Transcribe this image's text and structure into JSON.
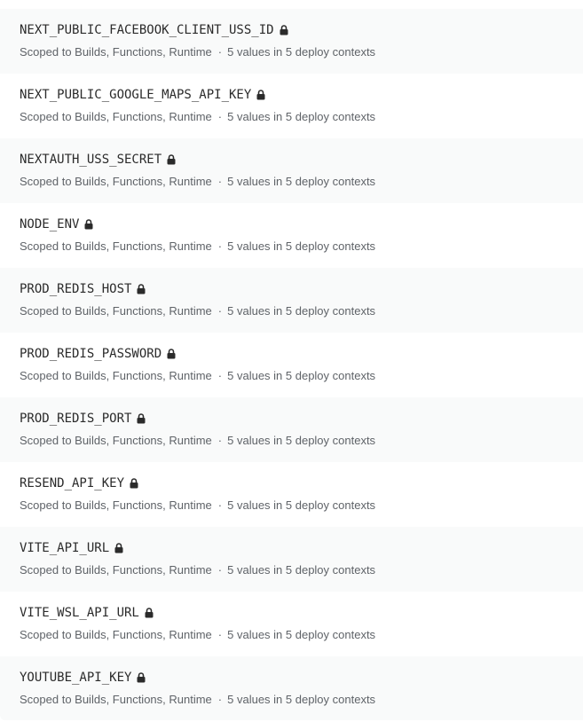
{
  "env_vars": [
    {
      "key": "NEXT_PUBLIC_FACEBOOK_CLIENT_USS_ID",
      "locked_icon": "lock-icon",
      "scope": "Scoped to Builds, Functions, Runtime",
      "separator": "·",
      "values": "5 values in 5 deploy contexts"
    },
    {
      "key": "NEXT_PUBLIC_GOOGLE_MAPS_API_KEY",
      "locked_icon": "lock-icon",
      "scope": "Scoped to Builds, Functions, Runtime",
      "separator": "·",
      "values": "5 values in 5 deploy contexts"
    },
    {
      "key": "NEXTAUTH_USS_SECRET",
      "locked_icon": "lock-icon",
      "scope": "Scoped to Builds, Functions, Runtime",
      "separator": "·",
      "values": "5 values in 5 deploy contexts"
    },
    {
      "key": "NODE_ENV",
      "locked_icon": "lock-icon",
      "scope": "Scoped to Builds, Functions, Runtime",
      "separator": "·",
      "values": "5 values in 5 deploy contexts"
    },
    {
      "key": "PROD_REDIS_HOST",
      "locked_icon": "lock-icon",
      "scope": "Scoped to Builds, Functions, Runtime",
      "separator": "·",
      "values": "5 values in 5 deploy contexts"
    },
    {
      "key": "PROD_REDIS_PASSWORD",
      "locked_icon": "lock-icon",
      "scope": "Scoped to Builds, Functions, Runtime",
      "separator": "·",
      "values": "5 values in 5 deploy contexts"
    },
    {
      "key": "PROD_REDIS_PORT",
      "locked_icon": "lock-icon",
      "scope": "Scoped to Builds, Functions, Runtime",
      "separator": "·",
      "values": "5 values in 5 deploy contexts"
    },
    {
      "key": "RESEND_API_KEY",
      "locked_icon": "lock-icon",
      "scope": "Scoped to Builds, Functions, Runtime",
      "separator": "·",
      "values": "5 values in 5 deploy contexts"
    },
    {
      "key": "VITE_API_URL",
      "locked_icon": "lock-icon",
      "scope": "Scoped to Builds, Functions, Runtime",
      "separator": "·",
      "values": "5 values in 5 deploy contexts"
    },
    {
      "key": "VITE_WSL_API_URL",
      "locked_icon": "lock-icon",
      "scope": "Scoped to Builds, Functions, Runtime",
      "separator": "·",
      "values": "5 values in 5 deploy contexts"
    },
    {
      "key": "YOUTUBE_API_KEY",
      "locked_icon": "lock-icon",
      "scope": "Scoped to Builds, Functions, Runtime",
      "separator": "·",
      "values": "5 values in 5 deploy contexts"
    }
  ],
  "colors": {
    "row_alt_bg": "#f9fafa",
    "row_bg": "#ffffff",
    "key_text": "#2b2b2b",
    "meta_text": "#5f6368",
    "lock_fill": "#2b2b2b"
  }
}
